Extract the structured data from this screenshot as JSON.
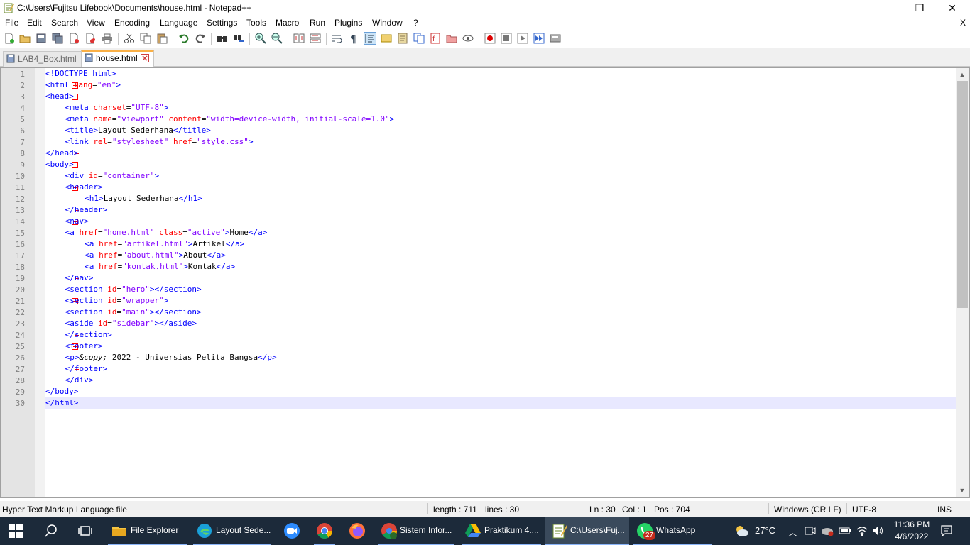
{
  "window": {
    "title": "C:\\Users\\Fujitsu Lifebook\\Documents\\house.html - Notepad++",
    "minimize": "—",
    "restore": "❐",
    "close": "✕"
  },
  "menu": {
    "items": [
      "File",
      "Edit",
      "Search",
      "View",
      "Encoding",
      "Language",
      "Settings",
      "Tools",
      "Macro",
      "Run",
      "Plugins",
      "Window",
      "?"
    ],
    "close_doc": "X"
  },
  "tabs": [
    {
      "label": "LAB4_Box.html",
      "active": false
    },
    {
      "label": "house.html",
      "active": true
    }
  ],
  "editor": {
    "current_line": 30,
    "lines": [
      {
        "n": "1",
        "indent": 0,
        "parts": [
          [
            "t",
            "<!DOCTYPE html>"
          ]
        ]
      },
      {
        "n": "2",
        "indent": 0,
        "parts": [
          [
            "t",
            "<html "
          ],
          [
            "a",
            "lang"
          ],
          [
            "x",
            "="
          ],
          [
            "v",
            "\"en\""
          ],
          [
            "t",
            ">"
          ]
        ]
      },
      {
        "n": "3",
        "indent": 0,
        "parts": [
          [
            "t",
            "<head>"
          ]
        ]
      },
      {
        "n": "4",
        "indent": 4,
        "parts": [
          [
            "t",
            "<meta "
          ],
          [
            "a",
            "charset"
          ],
          [
            "x",
            "="
          ],
          [
            "v",
            "\"UTF-8\""
          ],
          [
            "t",
            ">"
          ]
        ]
      },
      {
        "n": "5",
        "indent": 4,
        "parts": [
          [
            "t",
            "<meta "
          ],
          [
            "a",
            "name"
          ],
          [
            "x",
            "="
          ],
          [
            "v",
            "\"viewport\""
          ],
          [
            "x",
            " "
          ],
          [
            "a",
            "content"
          ],
          [
            "x",
            "="
          ],
          [
            "v",
            "\"width=device-width, initial-scale=1.0\""
          ],
          [
            "t",
            ">"
          ]
        ]
      },
      {
        "n": "6",
        "indent": 4,
        "parts": [
          [
            "t",
            "<title>"
          ],
          [
            "x",
            "Layout Sederhana"
          ],
          [
            "t",
            "</title>"
          ]
        ]
      },
      {
        "n": "7",
        "indent": 4,
        "parts": [
          [
            "t",
            "<link "
          ],
          [
            "a",
            "rel"
          ],
          [
            "x",
            "="
          ],
          [
            "v",
            "\"stylesheet\""
          ],
          [
            "x",
            " "
          ],
          [
            "a",
            "href"
          ],
          [
            "x",
            "="
          ],
          [
            "v",
            "\"style.css\""
          ],
          [
            "t",
            ">"
          ]
        ]
      },
      {
        "n": "8",
        "indent": 0,
        "parts": [
          [
            "t",
            "</head>"
          ]
        ]
      },
      {
        "n": "9",
        "indent": 0,
        "parts": [
          [
            "t",
            "<body>"
          ]
        ]
      },
      {
        "n": "10",
        "indent": 4,
        "parts": [
          [
            "t",
            "<div "
          ],
          [
            "a",
            "id"
          ],
          [
            "x",
            "="
          ],
          [
            "v",
            "\"container\""
          ],
          [
            "t",
            ">"
          ]
        ]
      },
      {
        "n": "11",
        "indent": 4,
        "parts": [
          [
            "t",
            "<header>"
          ]
        ]
      },
      {
        "n": "12",
        "indent": 8,
        "parts": [
          [
            "t",
            "<h1>"
          ],
          [
            "x",
            "Layout Sederhana"
          ],
          [
            "t",
            "</h1>"
          ]
        ]
      },
      {
        "n": "13",
        "indent": 4,
        "parts": [
          [
            "t",
            "</header>"
          ]
        ]
      },
      {
        "n": "14",
        "indent": 4,
        "parts": [
          [
            "t",
            "<nav>"
          ]
        ]
      },
      {
        "n": "15",
        "indent": 4,
        "parts": [
          [
            "t",
            "<a "
          ],
          [
            "a",
            "href"
          ],
          [
            "x",
            "="
          ],
          [
            "v",
            "\"home.html\""
          ],
          [
            "x",
            " "
          ],
          [
            "a",
            "class"
          ],
          [
            "x",
            "="
          ],
          [
            "v",
            "\"active\""
          ],
          [
            "t",
            ">"
          ],
          [
            "x",
            "Home"
          ],
          [
            "t",
            "</a>"
          ]
        ]
      },
      {
        "n": "16",
        "indent": 8,
        "parts": [
          [
            "t",
            "<a "
          ],
          [
            "a",
            "href"
          ],
          [
            "x",
            "="
          ],
          [
            "v",
            "\"artikel.html\""
          ],
          [
            "t",
            ">"
          ],
          [
            "x",
            "Artikel"
          ],
          [
            "t",
            "</a>"
          ]
        ]
      },
      {
        "n": "17",
        "indent": 8,
        "parts": [
          [
            "t",
            "<a "
          ],
          [
            "a",
            "href"
          ],
          [
            "x",
            "="
          ],
          [
            "v",
            "\"about.html\""
          ],
          [
            "t",
            ">"
          ],
          [
            "x",
            "About"
          ],
          [
            "t",
            "</a>"
          ]
        ]
      },
      {
        "n": "18",
        "indent": 8,
        "parts": [
          [
            "t",
            "<a "
          ],
          [
            "a",
            "href"
          ],
          [
            "x",
            "="
          ],
          [
            "v",
            "\"kontak.html\""
          ],
          [
            "t",
            ">"
          ],
          [
            "x",
            "Kontak"
          ],
          [
            "t",
            "</a>"
          ]
        ]
      },
      {
        "n": "19",
        "indent": 4,
        "parts": [
          [
            "t",
            "</nav>"
          ]
        ]
      },
      {
        "n": "20",
        "indent": 4,
        "parts": [
          [
            "t",
            "<section "
          ],
          [
            "a",
            "id"
          ],
          [
            "x",
            "="
          ],
          [
            "v",
            "\"hero\""
          ],
          [
            "t",
            "></section>"
          ]
        ]
      },
      {
        "n": "21",
        "indent": 4,
        "parts": [
          [
            "t",
            "<section "
          ],
          [
            "a",
            "id"
          ],
          [
            "x",
            "="
          ],
          [
            "v",
            "\"wrapper\""
          ],
          [
            "t",
            ">"
          ]
        ]
      },
      {
        "n": "22",
        "indent": 4,
        "parts": [
          [
            "t",
            "<section "
          ],
          [
            "a",
            "id"
          ],
          [
            "x",
            "="
          ],
          [
            "v",
            "\"main\""
          ],
          [
            "t",
            "></section>"
          ]
        ]
      },
      {
        "n": "23",
        "indent": 4,
        "parts": [
          [
            "t",
            "<aside "
          ],
          [
            "a",
            "id"
          ],
          [
            "x",
            "="
          ],
          [
            "v",
            "\"sidebar\""
          ],
          [
            "t",
            "></aside>"
          ]
        ]
      },
      {
        "n": "24",
        "indent": 4,
        "parts": [
          [
            "t",
            "</section>"
          ]
        ]
      },
      {
        "n": "25",
        "indent": 4,
        "parts": [
          [
            "t",
            "<footer>"
          ]
        ]
      },
      {
        "n": "26",
        "indent": 4,
        "parts": [
          [
            "t",
            "<p>"
          ],
          [
            "e",
            "&copy;"
          ],
          [
            "x",
            " 2022 - Universias Pelita Bangsa"
          ],
          [
            "t",
            "</p>"
          ]
        ]
      },
      {
        "n": "27",
        "indent": 4,
        "parts": [
          [
            "t",
            "</footer>"
          ]
        ]
      },
      {
        "n": "28",
        "indent": 4,
        "parts": [
          [
            "t",
            "</div>"
          ]
        ]
      },
      {
        "n": "29",
        "indent": 0,
        "parts": [
          [
            "t",
            "</body>"
          ]
        ]
      },
      {
        "n": "30",
        "indent": 0,
        "parts": [
          [
            "t",
            "</html>"
          ]
        ]
      }
    ]
  },
  "status": {
    "file_type": "Hyper Text Markup Language file",
    "length": "length : 711",
    "lines": "lines : 30",
    "ln": "Ln : 30",
    "col": "Col : 1",
    "pos": "Pos : 704",
    "eol": "Windows (CR LF)",
    "encoding": "UTF-8",
    "mode": "INS"
  },
  "taskbar": {
    "apps": [
      {
        "label": "File Explorer",
        "icon": "folder-icon"
      },
      {
        "label": "Layout Sede...",
        "icon": "edge-icon"
      },
      {
        "label": "",
        "icon": "zoom-icon"
      },
      {
        "label": "",
        "icon": "chrome-icon"
      },
      {
        "label": "",
        "icon": "firefox-icon"
      },
      {
        "label": "Sistem Infor...",
        "icon": "chrome-profile-icon"
      },
      {
        "label": "Praktikum 4....",
        "icon": "drive-icon"
      },
      {
        "label": "C:\\Users\\Fuj...",
        "icon": "notepadpp-icon"
      },
      {
        "label": "WhatsApp",
        "icon": "whatsapp-icon"
      }
    ],
    "whatsapp_badge": "27",
    "temperature": "27°C",
    "time": "11:36 PM",
    "date": "4/6/2022"
  },
  "colors": {
    "tag": "#0000ff",
    "attribute": "#ff0000",
    "value": "#8000ff",
    "taskbar": "#1c2a3a",
    "tab_accent": "#fab046"
  }
}
